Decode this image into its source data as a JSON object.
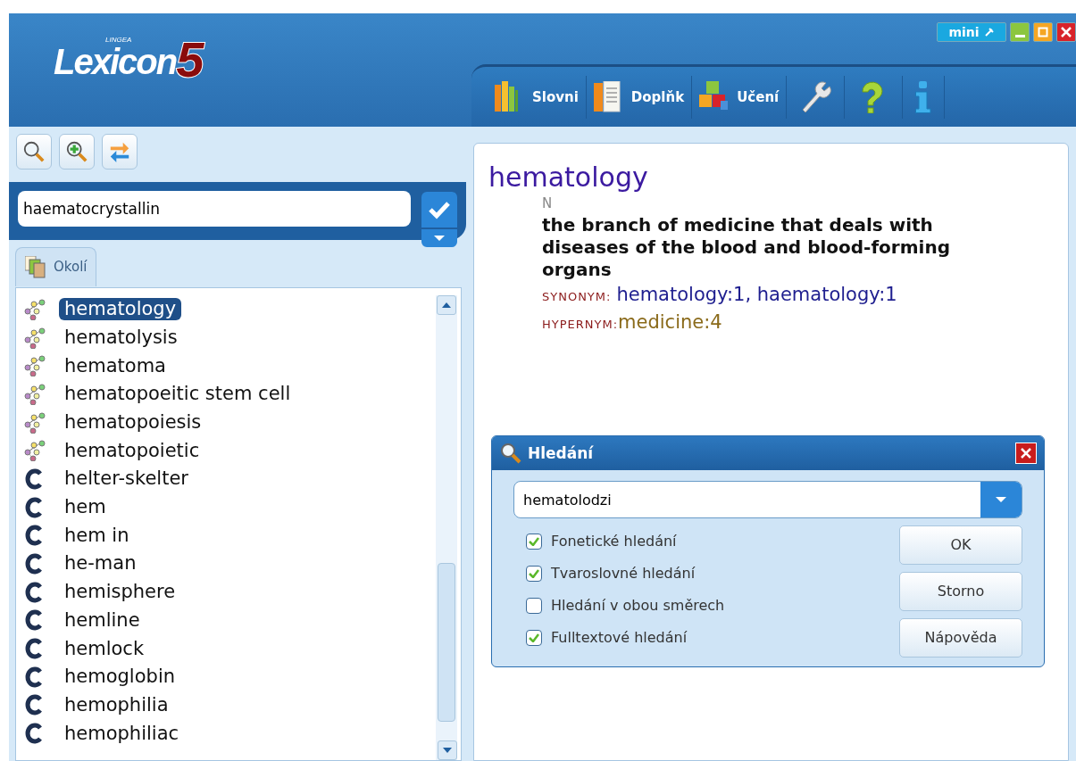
{
  "window": {
    "controls": [
      {
        "kind": "mini",
        "label": "mini"
      },
      {
        "kind": "minimize"
      },
      {
        "kind": "maximize"
      },
      {
        "kind": "close"
      }
    ]
  },
  "logo": {
    "brand": "LINGEA",
    "name": "Lexicon",
    "version": "5"
  },
  "toolbar": [
    {
      "kind": "books",
      "label": "Slovni"
    },
    {
      "kind": "pages",
      "label": "Doplňk"
    },
    {
      "kind": "blocks",
      "label": "Učení"
    },
    {
      "kind": "wrench"
    },
    {
      "kind": "help"
    },
    {
      "kind": "info"
    }
  ],
  "search_tools": [
    {
      "kind": "search"
    },
    {
      "kind": "zoom-in"
    },
    {
      "kind": "swap"
    }
  ],
  "search": {
    "value": "haematocrystallin"
  },
  "tabs": [
    {
      "label": "Okolí",
      "selected": true
    }
  ],
  "word_list": [
    {
      "kind": "synset",
      "text": "hematology",
      "selected": true
    },
    {
      "kind": "synset",
      "text": "hematolysis",
      "selected": false
    },
    {
      "kind": "synset",
      "text": "hematoma",
      "selected": false
    },
    {
      "kind": "synset",
      "text": "hematopoeitic stem cell",
      "selected": false
    },
    {
      "kind": "synset",
      "text": "hematopoiesis",
      "selected": false
    },
    {
      "kind": "synset",
      "text": "hematopoietic",
      "selected": false
    },
    {
      "kind": "collocation",
      "text": "helter-skelter",
      "selected": false
    },
    {
      "kind": "collocation",
      "text": "hem",
      "selected": false
    },
    {
      "kind": "collocation",
      "text": "hem in",
      "selected": false
    },
    {
      "kind": "collocation",
      "text": "he-man",
      "selected": false
    },
    {
      "kind": "collocation",
      "text": "hemisphere",
      "selected": false
    },
    {
      "kind": "collocation",
      "text": "hemline",
      "selected": false
    },
    {
      "kind": "collocation",
      "text": "hemlock",
      "selected": false
    },
    {
      "kind": "collocation",
      "text": "hemoglobin",
      "selected": false
    },
    {
      "kind": "collocation",
      "text": "hemophilia",
      "selected": false
    },
    {
      "kind": "collocation",
      "text": "hemophiliac",
      "selected": false
    }
  ],
  "entry": {
    "headword": "hematology",
    "pos": "N",
    "definition": "the branch of medicine that deals with diseases of the blood and blood-forming organs",
    "relations": [
      {
        "label": "SYNONYM:",
        "value": "hematology:1, haematology:1",
        "color": "#1f1f8f"
      },
      {
        "label": "HYPERNYM:",
        "value": "medicine:4",
        "color": "#8a6a1a"
      }
    ]
  },
  "dialog": {
    "title": "Hledání",
    "query": "hematolodzi",
    "options": [
      {
        "label": "Fonetické hledání",
        "checked": true
      },
      {
        "label": "Tvaroslovné hledání",
        "checked": true
      },
      {
        "label": "Hledání v obou směrech",
        "checked": false
      },
      {
        "label": "Fulltextové hledání",
        "checked": true
      }
    ],
    "buttons": [
      "OK",
      "Storno",
      "Nápověda"
    ]
  }
}
